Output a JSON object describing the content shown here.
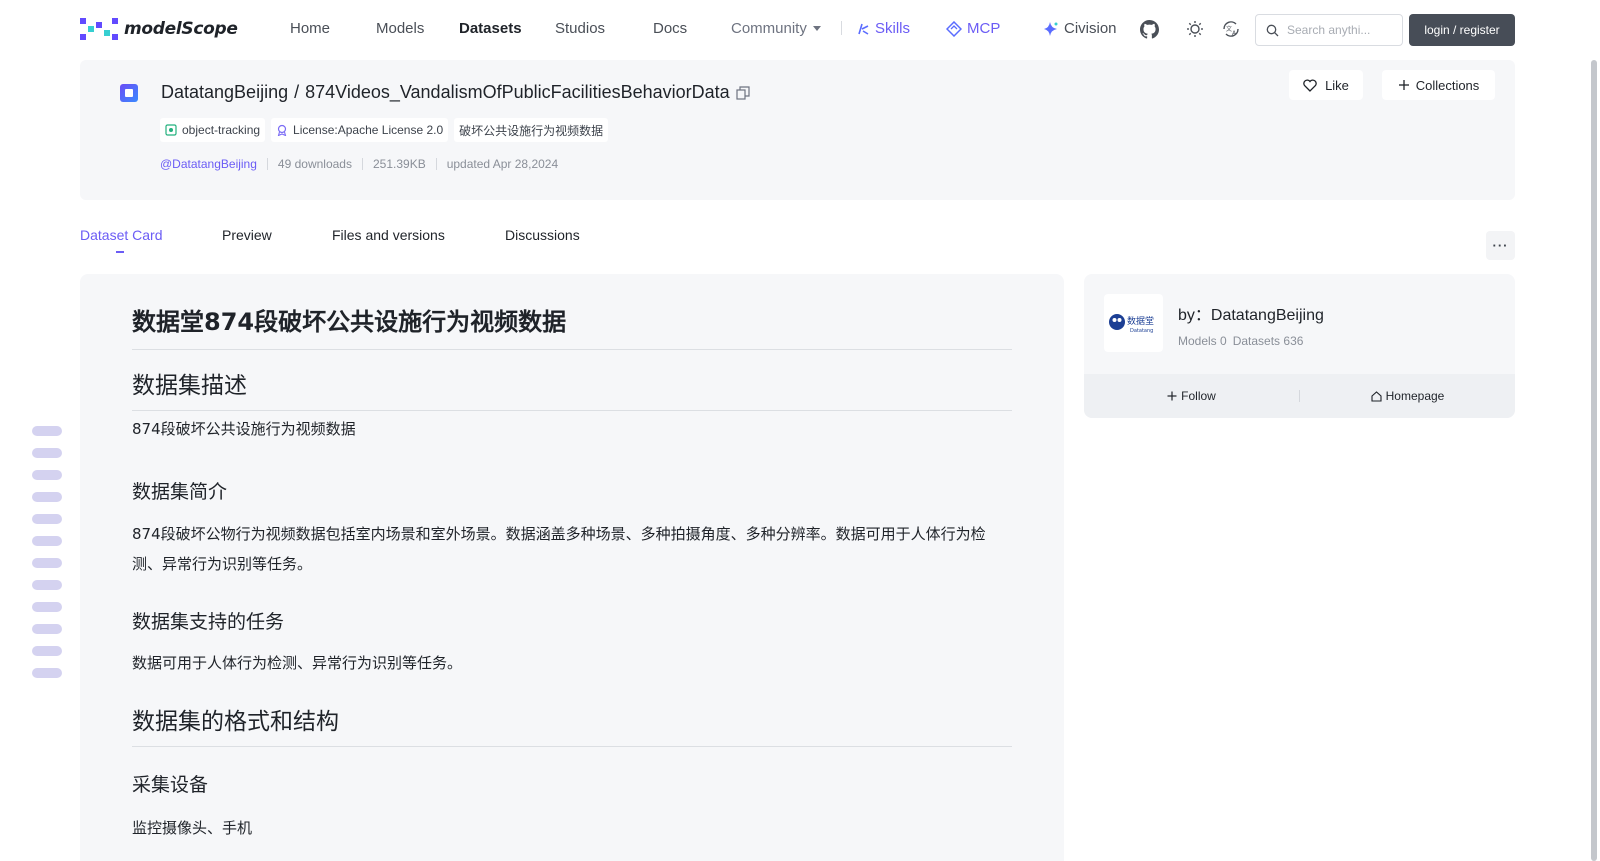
{
  "nav": {
    "logo_text": "modelScope",
    "links": [
      "Home",
      "Models",
      "Datasets",
      "Studios",
      "Docs"
    ],
    "community": "Community",
    "skills": "Skills",
    "mcp": "MCP",
    "civision": "Civision",
    "search_placeholder": "Search anythi...",
    "login": "login / register"
  },
  "dataset": {
    "owner": "DatatangBeijing",
    "slash": "/",
    "name": "874Videos_VandalismOfPublicFacilitiesBehaviorData",
    "tags": [
      "object-tracking",
      "License:Apache License 2.0",
      "破坏公共设施行为视频数据"
    ],
    "author_handle": "@DatatangBeijing",
    "downloads": "49 downloads",
    "size": "251.39KB",
    "updated": "updated Apr 28,2024",
    "like": "Like",
    "collections": "Collections"
  },
  "tabs": [
    "Dataset Card",
    "Preview",
    "Files and versions",
    "Discussions"
  ],
  "more": "···",
  "card": {
    "title": "数据堂874段破坏公共设施行为视频数据",
    "h_desc": "数据集描述",
    "p_desc": "874段破坏公共设施行为视频数据",
    "h_intro": "数据集简介",
    "p_intro": "874段破坏公物行为视频数据包括室内场景和室外场景。数据涵盖多种场景、多种拍摄角度、多种分辨率。数据可用于人体行为检测、异常行为识别等任务。",
    "h_tasks": "数据集支持的任务",
    "p_tasks": "数据可用于人体行为检测、异常行为识别等任务。",
    "h_format": "数据集的格式和结构",
    "h_device": "采集设备",
    "p_device": "监控摄像头、手机"
  },
  "author": {
    "by": "by：DatatangBeijing",
    "avatar_text": "数据堂",
    "avatar_sub": "Datatang",
    "models": "Models 0",
    "datasets": "Datasets 636",
    "follow": "Follow",
    "homepage": "Homepage"
  },
  "colors": {
    "accent": "#6b5cf5",
    "card_bg": "#f6f7f9",
    "login_bg": "#474d57"
  }
}
